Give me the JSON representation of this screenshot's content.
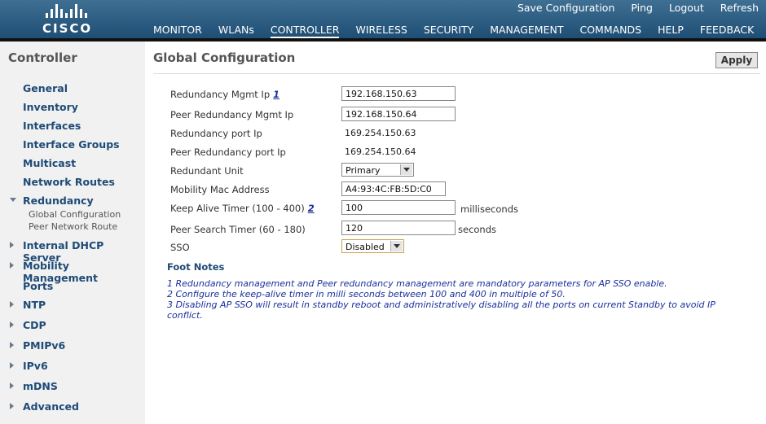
{
  "header": {
    "logo_text": "CISCO",
    "utils": [
      "Save Configuration",
      "Ping",
      "Logout",
      "Refresh"
    ],
    "nav": [
      "MONITOR",
      "WLANs",
      "CONTROLLER",
      "WIRELESS",
      "SECURITY",
      "MANAGEMENT",
      "COMMANDS",
      "HELP",
      "FEEDBACK"
    ],
    "active_nav": "CONTROLLER"
  },
  "sidebar": {
    "title": "Controller",
    "items": [
      "General",
      "Inventory",
      "Interfaces",
      "Interface Groups",
      "Multicast",
      "Network Routes",
      "Redundancy",
      "Internal DHCP Server",
      "Mobility Management",
      "Ports",
      "NTP",
      "CDP",
      "PMIPv6",
      "IPv6",
      "mDNS",
      "Advanced"
    ],
    "sub_items": [
      "Global Configuration",
      "Peer Network Route"
    ]
  },
  "main": {
    "title": "Global Configuration",
    "apply_label": "Apply",
    "fields": {
      "redundancy_mgmt_ip": {
        "label": "Redundancy Mgmt Ip",
        "note_ref": "1",
        "value": "192.168.150.63"
      },
      "peer_redundancy_mgmt_ip": {
        "label": "Peer Redundancy Mgmt Ip",
        "value": "192.168.150.64"
      },
      "redundancy_port_ip": {
        "label": "Redundancy port Ip",
        "value": "169.254.150.63"
      },
      "peer_redundancy_port_ip": {
        "label": "Peer Redundancy port Ip",
        "value": "169.254.150.64"
      },
      "redundant_unit": {
        "label": "Redundant Unit",
        "value": "Primary"
      },
      "mobility_mac": {
        "label": "Mobility Mac Address",
        "value": "A4:93:4C:FB:5D:C0"
      },
      "keep_alive": {
        "label": "Keep Alive Timer (100 - 400)",
        "note_ref": "2",
        "value": "100",
        "unit": "milliseconds"
      },
      "peer_search": {
        "label": "Peer Search Timer (60 - 180)",
        "value": "120",
        "unit": "seconds"
      },
      "sso": {
        "label": "SSO",
        "value": "Disabled"
      }
    },
    "footnotes_title": "Foot Notes",
    "footnotes": [
      "1 Redundancy management and Peer redundancy management are mandatory parameters for AP SSO enable.",
      "2 Configure the keep-alive timer in milli seconds between 100 and 400 in multiple of 50.",
      "3 Disabling AP SSO will result in standby reboot and administratively disabling all the ports on current Standby to avoid IP conflict."
    ]
  }
}
